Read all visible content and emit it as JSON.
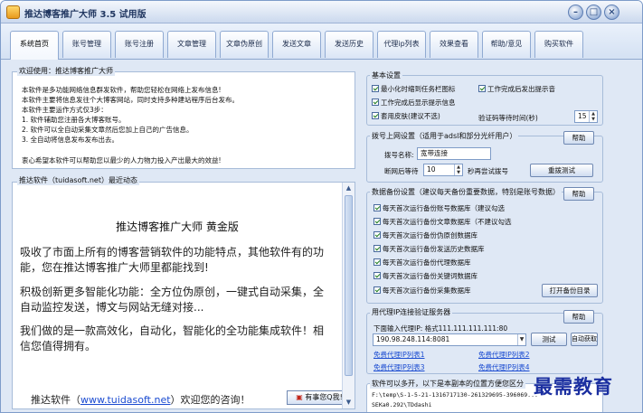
{
  "window": {
    "title": "推达博客推广大师 3.5 试用版"
  },
  "tabs": [
    {
      "label": "系统首页",
      "active": true
    },
    {
      "label": "账号管理"
    },
    {
      "label": "账号注册"
    },
    {
      "label": "文章管理"
    },
    {
      "label": "文章伪原创"
    },
    {
      "label": "发送文章"
    },
    {
      "label": "发送历史"
    },
    {
      "label": "代理ip列表"
    },
    {
      "label": "效果查看"
    },
    {
      "label": "帮助/意见"
    },
    {
      "label": "购买软件"
    }
  ],
  "welcome": {
    "title": "欢迎使用：推达博客推广大师",
    "lines": [
      "本软件是多功能网络信息群发软件，帮助您轻松在网络上发布信息!",
      "本软件主要将信息发往个大博客网站，同时支持多种建站程序后台发布。",
      "本软件主要运作方式仅3步：",
      "1. 软件辅助您注册各大博客账号。",
      "2. 软件可以全自动采集文章然后您加上自己的广告信息。",
      "3. 全自动将信息发布发布出去。",
      "衷心希望本软件可以帮助您以最少的人力物力投入产出最大的效益!"
    ]
  },
  "news": {
    "title": "推达软件（tuidasoft.net）最近动态",
    "headline": "推达博客推广大师 黄金版",
    "paragraphs": [
      "吸收了市面上所有的博客营销软件的功能特点，其他软件有的功",
      "能，您在推达博客推广大师里都能找到!",
      "积极创新更多智能化功能：全方位伪原创，一键式自动采集，全",
      "自动监控发送，博文与网站无缝对接...",
      "我们做的是一款高效化，自动化，智能化的全功能集成软件！相",
      "信您值得拥有。"
    ],
    "footer_prefix": "推达软件（",
    "footer_link": "www.tuidasoft.net",
    "footer_suffix": "）欢迎您的咨询！",
    "feedback_button": "有事您Q我!"
  },
  "basic_settings": {
    "title": "基本设置",
    "checkboxes": [
      "最小化时缩到任务栏图标",
      "工作完成后发出提示音",
      "工作完成后显示提示信息",
      "套用皮肤(建议不选)"
    ],
    "captcha_label": "验证码等待时间(秒)",
    "captcha_value": "15"
  },
  "dial_settings": {
    "title": "拨号上网设置（适用于adsl和部分光纤用户）",
    "help": "帮助",
    "name_label": "拨号名称:",
    "name_value": "宽带连接",
    "wait_label": "断网后等待",
    "wait_value": "10",
    "retry_label": "秒再尝试拨号",
    "test_button": "重拨测试"
  },
  "backup_settings": {
    "title": "数据备份设置（建议每天备份重要数据，特别是账号数据）",
    "help": "帮助",
    "checkboxes": [
      "每天首次运行备份账号数据库（建议勾选",
      "每天首次运行备份文章数据库（不建议勾选",
      "每天首次运行备份伪原创数据库",
      "每天首次运行备份发送历史数据库",
      "每天首次运行备份代理数据库",
      "每天首次运行备份关键词数据库",
      "每天首次运行备份采集数据库"
    ],
    "open_button": "打开备份目录"
  },
  "proxy_settings": {
    "title": "用代理IP连接验证服务器",
    "help": "帮助",
    "hint": "下面输入代理IP: 格式111.111.111.111:80",
    "ip_value": "190.98.248.114:8081",
    "test_button": "测试",
    "auto_button": "自动获取",
    "links": [
      "免费代理IP列表1",
      "免费代理IP列表2",
      "免费代理IP列表3",
      "免费代理IP列表4"
    ]
  },
  "copy_settings": {
    "title": "软件可以多开，以下是本副本的位置方便您区分",
    "path_line1": "F:\\temp\\S-1-5-21-1316717130-261329695-396069...",
    "path_line2": "SEKa0.292\\TDdashi"
  },
  "watermark": "最需教育"
}
